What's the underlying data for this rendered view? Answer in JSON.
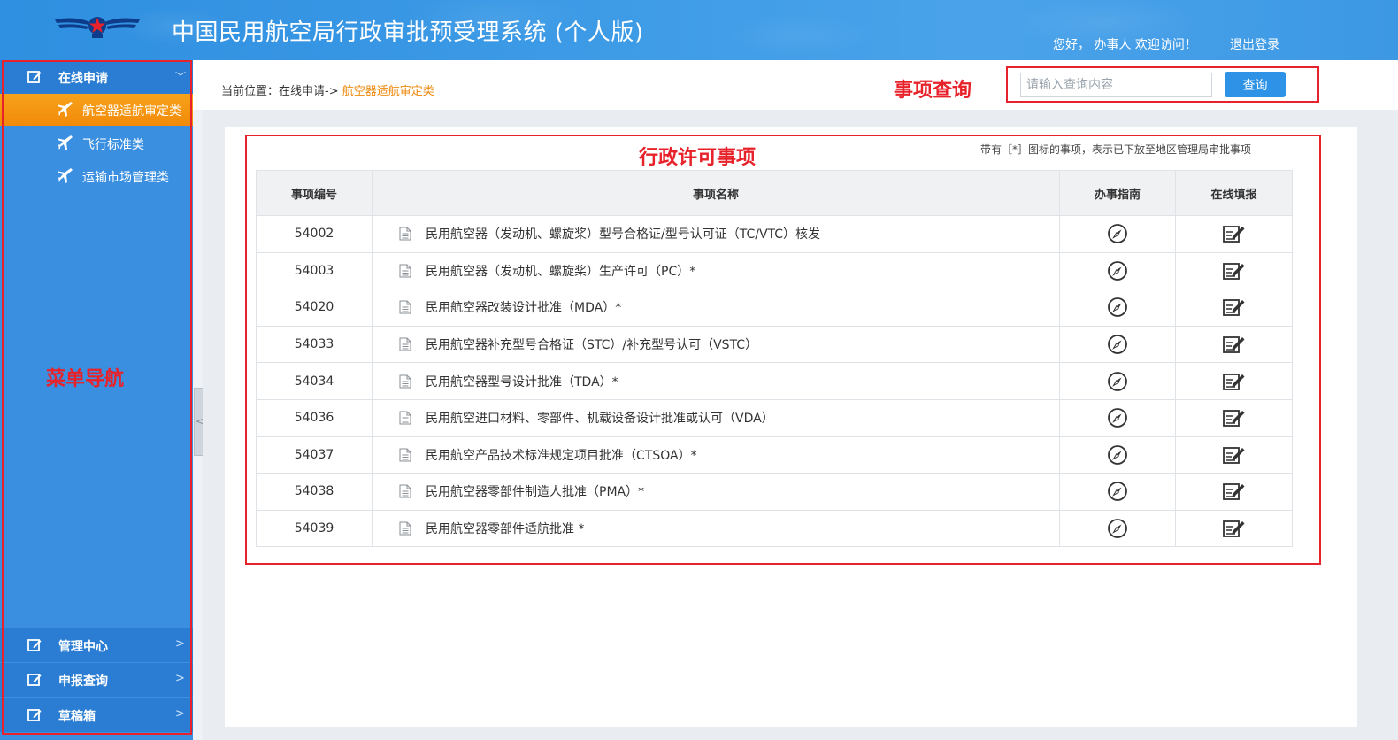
{
  "header": {
    "title": "中国民用航空局行政审批预受理系统 (个人版)",
    "greeting": "您好， 办事人  欢迎访问！",
    "logout": "退出登录",
    "colors": {
      "bg": "#3c9ae6",
      "accent": "#f28a09",
      "annotation": "#e8222a"
    }
  },
  "sidebar": {
    "group_online": {
      "label": "在线申请",
      "icon": "edit-icon",
      "chevron": "﹀"
    },
    "sub_items": [
      {
        "label": "航空器适航审定类",
        "icon": "plane-icon",
        "active": true
      },
      {
        "label": "飞行标准类",
        "icon": "plane-icon",
        "active": false
      },
      {
        "label": "运输市场管理类",
        "icon": "plane-icon",
        "active": false
      }
    ],
    "bottom_groups": [
      {
        "label": "管理中心",
        "icon": "edit-icon",
        "chevron": ">"
      },
      {
        "label": "申报查询",
        "icon": "edit-icon",
        "chevron": ">"
      },
      {
        "label": "草稿箱",
        "icon": "edit-icon",
        "chevron": ">"
      }
    ],
    "annotation": "菜单导航",
    "collapse_glyph": "<"
  },
  "breadcrumb": {
    "prefix": "当前位置：在线申请->",
    "current": "航空器适航审定类"
  },
  "search": {
    "annotation": "事项查询",
    "placeholder": "请输入查询内容",
    "button": "查询"
  },
  "table": {
    "annotation": "行政许可事项",
    "note": "带有［*］图标的事项，表示已下放至地区管理局审批事项",
    "headers": [
      "事项编号",
      "事项名称",
      "办事指南",
      "在线填报"
    ],
    "rows": [
      {
        "code": "54002",
        "name": "民用航空器（发动机、螺旋桨）型号合格证/型号认可证（TC/VTC）核发"
      },
      {
        "code": "54003",
        "name": "民用航空器（发动机、螺旋桨）生产许可（PC）*"
      },
      {
        "code": "54020",
        "name": "民用航空器改装设计批准（MDA）*"
      },
      {
        "code": "54033",
        "name": "民用航空器补充型号合格证（STC）/补充型号认可（VSTC）"
      },
      {
        "code": "54034",
        "name": "民用航空器型号设计批准（TDA）*"
      },
      {
        "code": "54036",
        "name": "民用航空进口材料、零部件、机载设备设计批准或认可（VDA）"
      },
      {
        "code": "54037",
        "name": "民用航空产品技术标准规定项目批准（CTSOA）*"
      },
      {
        "code": "54038",
        "name": "民用航空器零部件制造人批准（PMA）*"
      },
      {
        "code": "54039",
        "name": "民用航空器零部件适航批准 *"
      }
    ],
    "guide_icon": "compass-icon",
    "fill_icon": "edit-form-icon"
  }
}
